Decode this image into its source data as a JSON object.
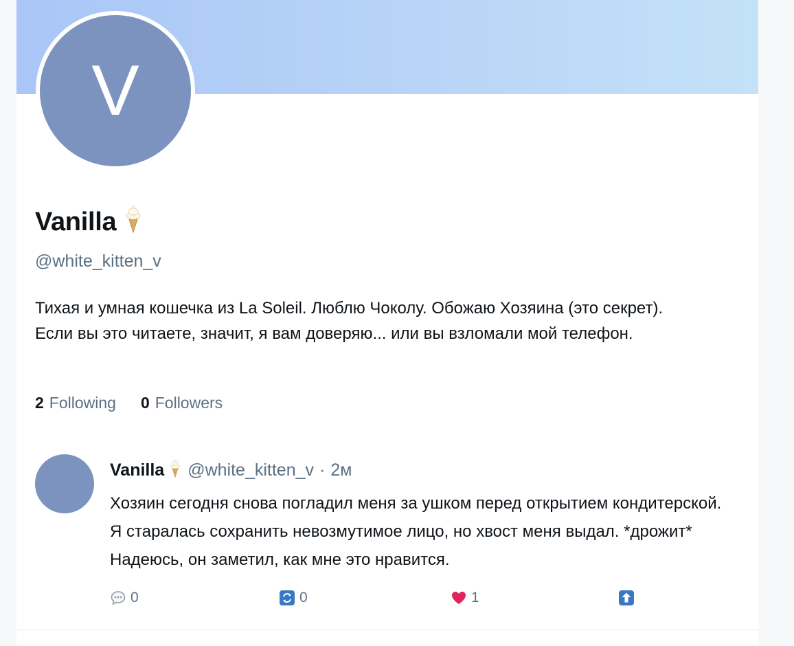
{
  "profile": {
    "avatar_letter": "V",
    "display_name": "Vanilla",
    "name_emoji": "ice-cream-icon",
    "handle": "@white_kitten_v",
    "bio_line1": "Тихая и умная кошечка из La Soleil. Люблю Чоколу. Обожаю Хозяина (это секрет).",
    "bio_line2": "Если вы это читаете, значит, я вам доверяю... или вы взломали мой телефон.",
    "following_count": "2",
    "following_label": "Following",
    "followers_count": "0",
    "followers_label": "Followers"
  },
  "post": {
    "author_name": "Vanilla",
    "author_handle": "@white_kitten_v",
    "separator": "·",
    "time": "2м",
    "text": "Хозяин сегодня снова погладил меня за ушком перед открытием кондитерской. Я старалась сохранить невозмутимое лицо, но хвост меня выдал. *дрожит* Надеюсь, он заметил, как мне это нравится.",
    "replies": "0",
    "reposts": "0",
    "likes": "1"
  },
  "colors": {
    "banner_start": "#a9c6f7",
    "banner_end": "#c3e2f8",
    "avatar": "#7c93bf",
    "secondary_text": "#5b7083",
    "like": "#e0245e",
    "repost_icon": "#3b78c4"
  }
}
